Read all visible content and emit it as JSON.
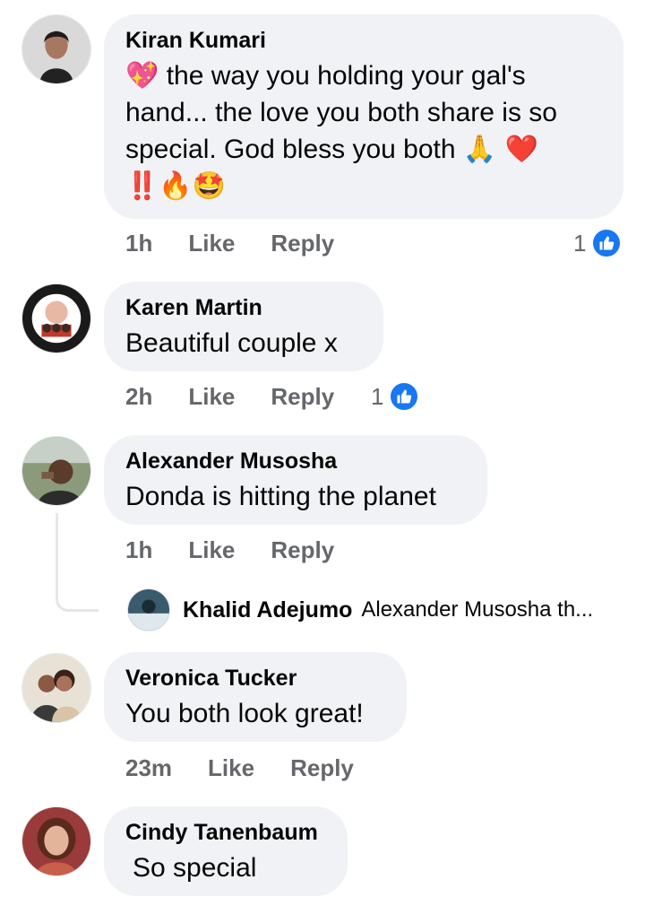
{
  "comments": [
    {
      "name": "Kiran Kumari",
      "line1": "the way you holding your gal's",
      "line2": "hand... the love you both share is so",
      "line3": "special. God bless you both",
      "emoji_lead": "💖",
      "emoji_line3": "🙏 ❤️",
      "emoji_line4": "‼️🔥🤩",
      "time": "1h",
      "like_label": "Like",
      "reply_label": "Reply",
      "reactions": "1"
    },
    {
      "name": "Karen Martin",
      "text": "Beautiful couple x",
      "time": "2h",
      "like_label": "Like",
      "reply_label": "Reply",
      "reactions": "1"
    },
    {
      "name": "Alexander Musosha",
      "text": "Donda is hitting the planet",
      "time": "1h",
      "like_label": "Like",
      "reply_label": "Reply"
    },
    {
      "name": "Veronica Tucker",
      "text": "You both look great!",
      "time": "23m",
      "like_label": "Like",
      "reply_label": "Reply"
    },
    {
      "name": "Cindy Tanenbaum",
      "text": "So special"
    }
  ],
  "reply_preview": {
    "name": "Khalid Adejumo",
    "text": "Alexander Musosha th..."
  },
  "colors": {
    "bubble": "#f0f2f5",
    "meta": "#65676b",
    "like_blue": "#1877f2"
  },
  "icons": [
    "like-thumb-icon"
  ]
}
